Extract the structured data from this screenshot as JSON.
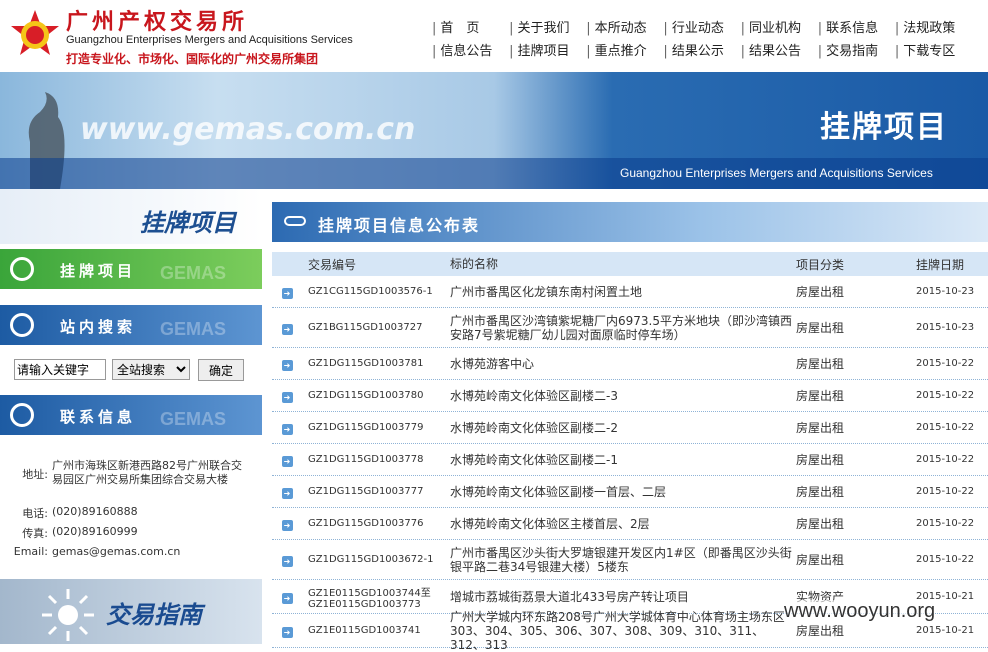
{
  "header": {
    "cn_name": "广州产权交易所",
    "en_name": "Guangzhou Enterprises Mergers and Acquisitions Services",
    "slogan": "打造专业化、市场化、国际化的广州交易所集团"
  },
  "nav": {
    "row1": [
      "首　页",
      "关于我们",
      "本所动态",
      "行业动态",
      "同业机构",
      "联系信息",
      "法规政策"
    ],
    "row2": [
      "信息公告",
      "挂牌项目",
      "重点推介",
      "结果公示",
      "结果公告",
      "交易指南",
      "下载专区"
    ]
  },
  "banner": {
    "url": "www.gemas.com.cn",
    "title": "挂牌项目",
    "en": "Guangzhou Enterprises Mergers and Acquisitions Services"
  },
  "sidebar": {
    "title": "挂牌项目",
    "bar_listing": "挂牌项目",
    "bar_search": "站内搜索",
    "bar_contact": "联系信息",
    "watermark": "GEMAS",
    "search_value": "请输入关键字",
    "search_scope": "全站搜索",
    "search_button": "确定",
    "contact": {
      "address_key": "地址:",
      "address": "广州市海珠区新港西路82号广州联合交易园区广州交易所集团综合交易大楼",
      "phone_key": "电话:",
      "phone": "(020)89160888",
      "fax_key": "传真:",
      "fax": "(020)89160999",
      "email_key": "Email:",
      "email": "gemas@gemas.com.cn"
    },
    "guide": "交易指南"
  },
  "main": {
    "title": "挂牌项目信息公布表",
    "columns": [
      "交易编号",
      "标的名称",
      "项目分类",
      "挂牌日期"
    ],
    "rows": [
      {
        "id": "GZ1CG115GD1003576-1",
        "name": "广州市番禺区化龙镇东南村闲置土地",
        "type": "房屋出租",
        "date": "2015-10-23",
        "h": 32
      },
      {
        "id": "GZ1BG115GD1003727",
        "name": "广州市番禺区沙湾镇紫坭糖厂内6973.5平方米地块（即沙湾镇西安路7号紫坭糖厂幼儿园对面原临时停车场）",
        "type": "房屋出租",
        "date": "2015-10-23",
        "h": 40
      },
      {
        "id": "GZ1DG115GD1003781",
        "name": "水博苑游客中心",
        "type": "房屋出租",
        "date": "2015-10-22",
        "h": 32
      },
      {
        "id": "GZ1DG115GD1003780",
        "name": "水博苑岭南文化体验区副楼二-3",
        "type": "房屋出租",
        "date": "2015-10-22",
        "h": 32
      },
      {
        "id": "GZ1DG115GD1003779",
        "name": "水博苑岭南文化体验区副楼二-2",
        "type": "房屋出租",
        "date": "2015-10-22",
        "h": 32
      },
      {
        "id": "GZ1DG115GD1003778",
        "name": "水博苑岭南文化体验区副楼二-1",
        "type": "房屋出租",
        "date": "2015-10-22",
        "h": 32
      },
      {
        "id": "GZ1DG115GD1003777",
        "name": "水博苑岭南文化体验区副楼一首层、二层",
        "type": "房屋出租",
        "date": "2015-10-22",
        "h": 32
      },
      {
        "id": "GZ1DG115GD1003776",
        "name": "水博苑岭南文化体验区主楼首层、2层",
        "type": "房屋出租",
        "date": "2015-10-22",
        "h": 32
      },
      {
        "id": "GZ1DG115GD1003672-1",
        "name": "广州市番禺区沙头街大罗塘银建开发区内1#区（即番禺区沙头街银平路二巷34号银建大楼）5楼东",
        "type": "房屋出租",
        "date": "2015-10-22",
        "h": 40
      },
      {
        "id": "GZ1E0115GD1003744至GZ1E0115GD1003773",
        "name": "增城市荔城街荔景大道北433号房产转让项目",
        "type": "实物资产",
        "date": "2015-10-21",
        "h": 34
      },
      {
        "id": "GZ1E0115GD1003741",
        "name": "广州大学城内环东路208号广州大学城体育中心体育场主场东区303、304、305、306、307、308、309、310、311、312、313",
        "type": "房屋出租",
        "date": "2015-10-21",
        "h": 34
      }
    ]
  },
  "watermark": "www.wooyun.org"
}
